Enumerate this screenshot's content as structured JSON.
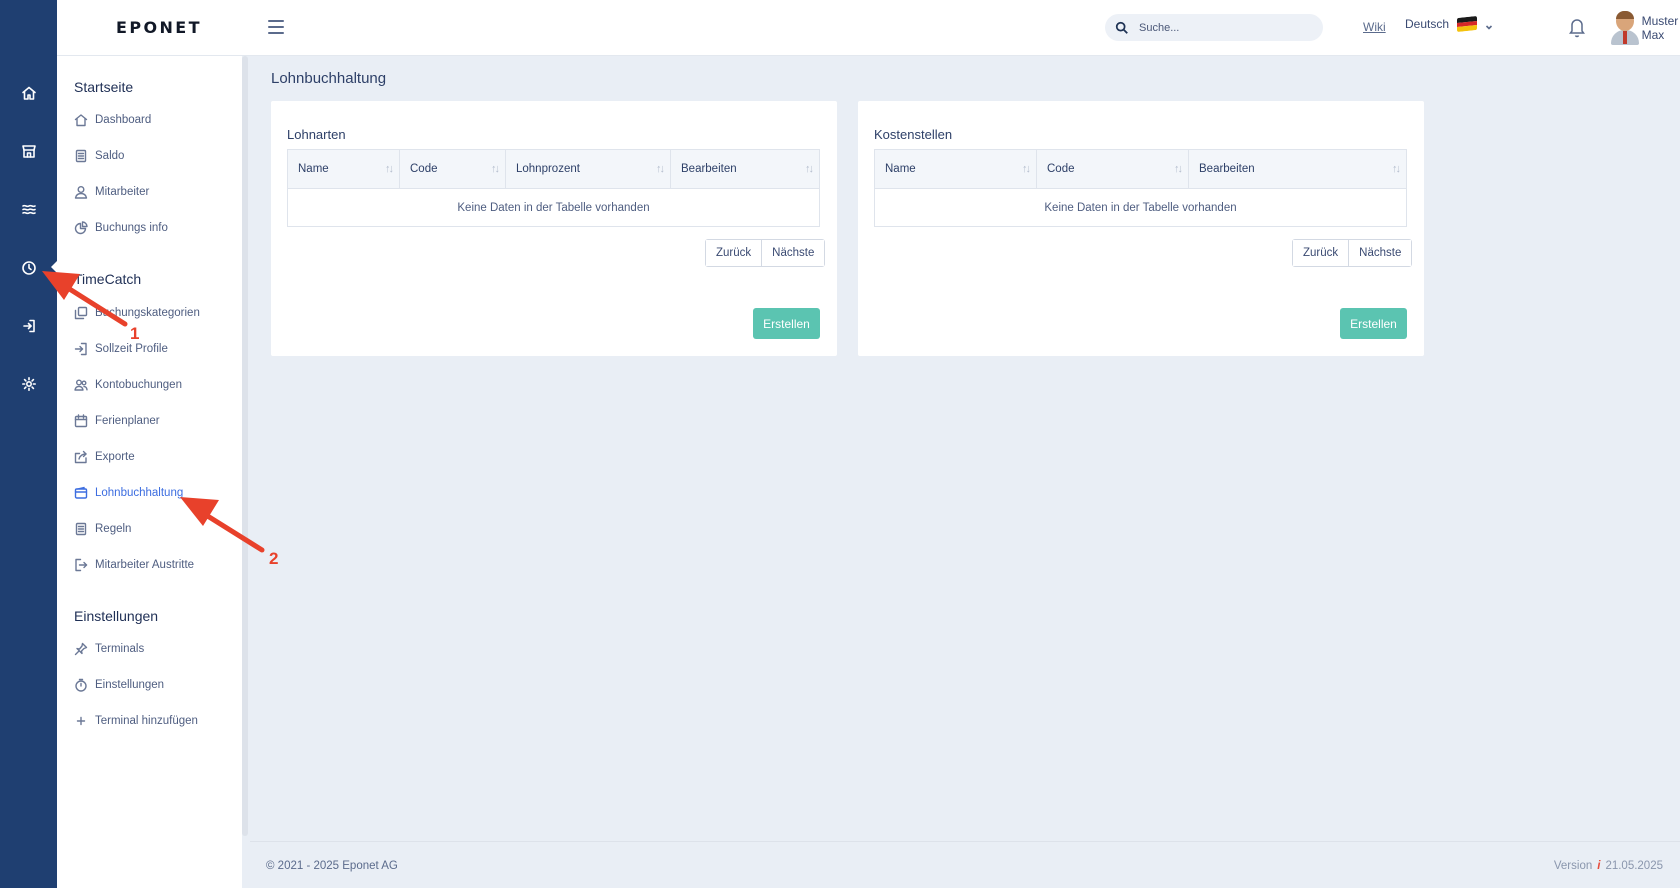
{
  "header": {
    "logo": "EPONET",
    "search_placeholder": "Suche...",
    "wiki": "Wiki",
    "language": "Deutsch",
    "user_name": "Muster Max"
  },
  "sidebar": {
    "sections": [
      {
        "title": "Startseite",
        "items": [
          {
            "label": "Dashboard",
            "icon": "home-icon"
          },
          {
            "label": "Saldo",
            "icon": "document-icon"
          },
          {
            "label": "Mitarbeiter",
            "icon": "user-icon"
          },
          {
            "label": "Buchungs info",
            "icon": "pie-chart-icon"
          }
        ]
      },
      {
        "title": "TimeCatch",
        "items": [
          {
            "label": "Buchungskategorien",
            "icon": "copy-icon"
          },
          {
            "label": "Sollzeit Profile",
            "icon": "login-icon"
          },
          {
            "label": "Kontobuchungen",
            "icon": "users-icon"
          },
          {
            "label": "Ferienplaner",
            "icon": "calendar-icon"
          },
          {
            "label": "Exporte",
            "icon": "share-icon"
          },
          {
            "label": "Lohnbuchhaltung",
            "icon": "wallet-icon",
            "active": true
          },
          {
            "label": "Regeln",
            "icon": "document-icon"
          },
          {
            "label": "Mitarbeiter Austritte",
            "icon": "logout-icon"
          }
        ]
      },
      {
        "title": "Einstellungen",
        "items": [
          {
            "label": "Terminals",
            "icon": "pin-icon"
          },
          {
            "label": "Einstellungen",
            "icon": "timer-icon"
          },
          {
            "label": "Terminal hinzufügen",
            "icon": "plus-icon"
          }
        ]
      }
    ]
  },
  "rail": {
    "items": [
      "home-icon",
      "store-icon",
      "waves-icon",
      "clock-icon",
      "login-icon",
      "gear-icon"
    ]
  },
  "main": {
    "page_title": "Lohnbuchhaltung",
    "cards": [
      {
        "title": "Lohnarten",
        "columns": [
          "Name",
          "Code",
          "Lohnprozent",
          "Bearbeiten"
        ],
        "empty_text": "Keine Daten in der Tabelle vorhanden",
        "prev": "Zurück",
        "next": "Nächste",
        "create": "Erstellen"
      },
      {
        "title": "Kostenstellen",
        "columns": [
          "Name",
          "Code",
          "Bearbeiten"
        ],
        "empty_text": "Keine Daten in der Tabelle vorhanden",
        "prev": "Zurück",
        "next": "Nächste",
        "create": "Erstellen"
      }
    ]
  },
  "footer": {
    "copyright": "© 2021 - 2025 Eponet AG",
    "version_label": "Version",
    "version_info_icon": "i",
    "version_date": "21.05.2025"
  },
  "annotations": {
    "marker_1": "1",
    "marker_2": "2"
  },
  "colors": {
    "rail": "#1f3f71",
    "accent": "#3c6de0",
    "create_button": "#5bc4b1",
    "annotation": "#e8412b"
  }
}
